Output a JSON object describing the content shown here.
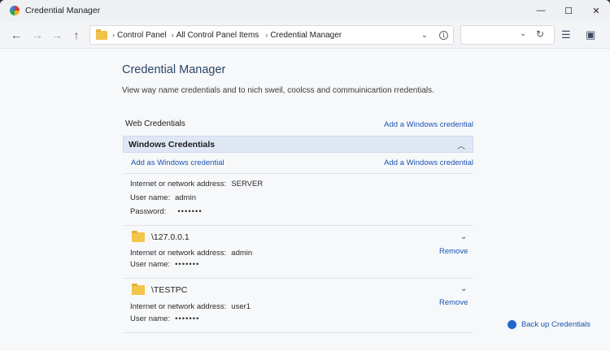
{
  "window": {
    "title": "Credential Manager",
    "controls": {
      "minimize": "—",
      "maximize": "☐",
      "close": "✕"
    }
  },
  "nav": {
    "breadcrumb": [
      "Control Panel",
      "All Control Panel Items",
      "Credential Manager"
    ],
    "icons": [
      "back-arrow-icon",
      "forward-arrow-icon",
      "forward-arrow-icon",
      "up-arrow-icon",
      "folder-icon",
      "chevron-down-icon",
      "info-icon",
      "refresh-icon",
      "list-view-icon",
      "details-pane-icon"
    ]
  },
  "page": {
    "title": "Credential Manager",
    "description": "View way name credentials and to nich sweil, coolcss and commuinicartion rredentials."
  },
  "web_credentials": {
    "label": "Web Credentials",
    "add_link": "Add a Windows credential"
  },
  "windows_credentials": {
    "label": "Windows Credentials",
    "add_link_left": "Add as Windows credential",
    "add_link_right": "Add a Windows credential",
    "server_entry": {
      "address_label": "Internet or network address:",
      "address_value": "SERVER",
      "user_label": "User name:",
      "user_value": "admin",
      "password_label": "Password:",
      "password_value": "•••••••"
    },
    "entries": [
      {
        "name": "\\127.0.0.1",
        "address_label": "Internet or network address:",
        "address_value": "admin",
        "user_label": "User name:",
        "user_value": "•••••••",
        "remove_label": "Remove"
      },
      {
        "name": "\\TESTPC",
        "address_label": "Internet or network address:",
        "address_value": "user1",
        "user_label": "User name:",
        "user_value": "•••••••",
        "remove_label": "Remove"
      }
    ]
  },
  "backup_link": "Back up Credentials",
  "colors": {
    "accent": "#1a55b3",
    "header_bg": "#dfe7f5",
    "title": "#2b4566"
  }
}
